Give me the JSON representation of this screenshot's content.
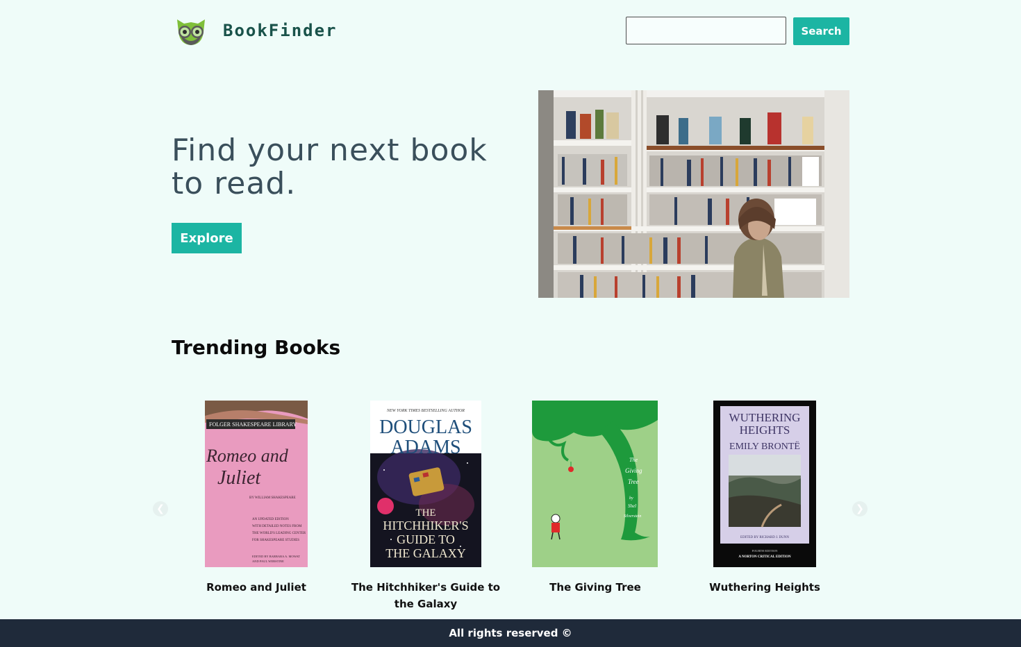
{
  "header": {
    "brand": "BookFinder",
    "search": {
      "value": "",
      "placeholder": ""
    },
    "search_button": "Search"
  },
  "hero": {
    "title": "Find your next book to read.",
    "explore_button": "Explore"
  },
  "trending": {
    "heading": "Trending Books",
    "prev_arrow": "❮",
    "next_arrow": "❯",
    "books": [
      {
        "title": "Romeo and Juliet",
        "cover": {
          "series": "FOLGER SHAKESPEARE LIBRARY",
          "script_line1": "Romeo and",
          "script_line2": "Juliet",
          "author": "BY WILLIAM SHAKESPEARE",
          "blurb": [
            "AN UPDATED EDITION",
            "WITH DETAILED NOTES FROM",
            "THE WORLD'S LEADING CENTER",
            "FOR SHAKESPEARE STUDIES"
          ],
          "editors": [
            "EDITED BY BARBARA A. MOWAT",
            "AND PAUL WERSTINE"
          ]
        }
      },
      {
        "title": "The Hitchhiker's Guide to the Galaxy",
        "cover": {
          "tagline": "NEW YORK TIMES BESTSELLING AUTHOR",
          "author_line1": "DOUGLAS",
          "author_line2": "ADAMS",
          "title_line1": "THE",
          "title_line2": "HITCHHIKER'S",
          "title_line3": "GUIDE TO",
          "title_line4": "THE GALAXY"
        }
      },
      {
        "title": "The Giving Tree",
        "cover": {
          "line1": "The",
          "line2": "Giving",
          "line3": "Tree",
          "line4": "by",
          "line5": "Shel",
          "line6": "Silverstein"
        }
      },
      {
        "title": "Wuthering Heights",
        "cover": {
          "title_line1": "WUTHERING",
          "title_line2": "HEIGHTS",
          "author": "EMILY BRONTË",
          "editor": "EDITED BY RICHARD J. DUNN",
          "edition_line1": "FOURTH EDITION",
          "edition_line2": "A NORTON CRITICAL EDITION"
        }
      }
    ]
  },
  "footer": {
    "text": "All rights reserved ©"
  },
  "colors": {
    "background": "#effcf9",
    "accent": "#1cb5a3",
    "brand_text": "#19524a",
    "hero_text": "#3a4f5b",
    "footer_bg": "#1f2a3a"
  }
}
